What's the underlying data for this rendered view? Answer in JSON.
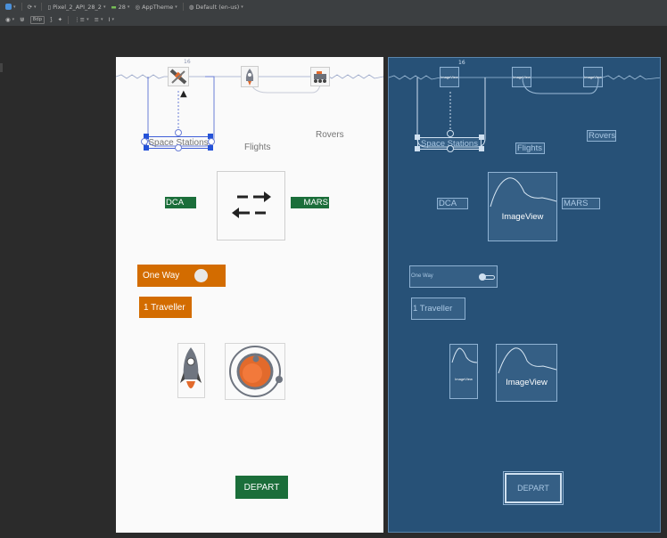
{
  "toolbar_top": {
    "device": "Pixel_2_API_28_2",
    "api": "28",
    "theme": "AppTheme",
    "locale": "Default (en-us)"
  },
  "toolbar_second": {
    "margin": "8dp"
  },
  "design": {
    "margin_marker": "16",
    "space_stations": "Space Stations",
    "flights": "Flights",
    "rovers": "Rovers",
    "origin": "DCA",
    "destination": "MARS",
    "trip_type": "One Way",
    "travellers": "1 Traveller",
    "depart": "DEPART"
  },
  "blueprint": {
    "margin_marker": "16",
    "space_stations": "Space Stations",
    "flights": "Flights",
    "rovers": "Rovers",
    "origin": "DCA",
    "destination": "MARS",
    "image_view": "ImageView",
    "image_view_small": "ImageView",
    "one_way": "One Way",
    "travellers": "1 Traveller",
    "depart": "DEPART"
  },
  "colors": {
    "green": "#1b6e3a",
    "orange": "#d36c00",
    "blueprint_bg": "#275177",
    "selection": "#2452d8"
  }
}
